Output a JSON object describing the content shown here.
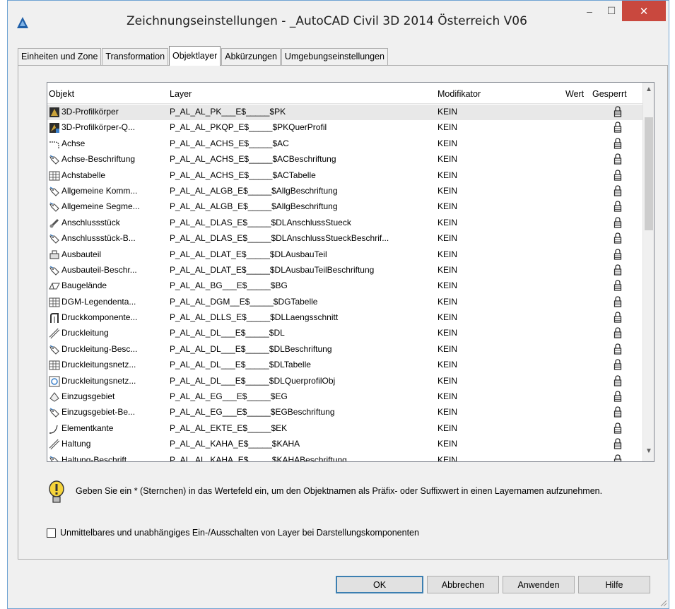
{
  "window": {
    "title": "Zeichnungseinstellungen - _AutoCAD Civil 3D 2014 Österreich V06",
    "minimize": "–",
    "maximize": "☐",
    "close": "✕"
  },
  "tabs": [
    {
      "label": "Einheiten und Zone",
      "active": false
    },
    {
      "label": "Transformation",
      "active": false
    },
    {
      "label": "Objektlayer",
      "active": true
    },
    {
      "label": "Abkürzungen",
      "active": false
    },
    {
      "label": "Umgebungseinstellungen",
      "active": false
    }
  ],
  "table": {
    "headers": {
      "object": "Objekt",
      "layer": "Layer",
      "modifier": "Modifikator",
      "value": "Wert",
      "locked": "Gesperrt"
    },
    "rows": [
      {
        "icon": "profile-body-icon",
        "object": "3D-Profilkörper",
        "layer": "P_AL_AL_PK___E$_____$PK",
        "modifier": "KEIN",
        "value": "",
        "locked": true
      },
      {
        "icon": "profile-body-cross-icon",
        "object": "3D-Profilkörper-Q...",
        "layer": "P_AL_AL_PKQP_E$_____$PKQuerProfil",
        "modifier": "KEIN",
        "value": "",
        "locked": true
      },
      {
        "icon": "alignment-icon",
        "object": "Achse",
        "layer": "P_AL_AL_ACHS_E$_____$AC",
        "modifier": "KEIN",
        "value": "",
        "locked": true
      },
      {
        "icon": "label-tag-icon",
        "object": "Achse-Beschriftung",
        "layer": "P_AL_AL_ACHS_E$_____$ACBeschriftung",
        "modifier": "KEIN",
        "value": "",
        "locked": true
      },
      {
        "icon": "table-icon",
        "object": "Achstabelle",
        "layer": "P_AL_AL_ACHS_E$_____$ACTabelle",
        "modifier": "KEIN",
        "value": "",
        "locked": true
      },
      {
        "icon": "label-tag-icon",
        "object": "Allgemeine Komm...",
        "layer": "P_AL_AL_ALGB_E$_____$AllgBeschriftung",
        "modifier": "KEIN",
        "value": "",
        "locked": true
      },
      {
        "icon": "label-tag-icon",
        "object": "Allgemeine Segme...",
        "layer": "P_AL_AL_ALGB_E$_____$AllgBeschriftung",
        "modifier": "KEIN",
        "value": "",
        "locked": true
      },
      {
        "icon": "fitting-icon",
        "object": "Anschlussstück",
        "layer": "P_AL_AL_DLAS_E$_____$DLAnschlussStueck",
        "modifier": "KEIN",
        "value": "",
        "locked": true
      },
      {
        "icon": "label-tag-icon",
        "object": "Anschlussstück-B...",
        "layer": "P_AL_AL_DLAS_E$_____$DLAnschlussStueckBeschrif...",
        "modifier": "KEIN",
        "value": "",
        "locked": true
      },
      {
        "icon": "appurtenance-icon",
        "object": "Ausbauteil",
        "layer": "P_AL_AL_DLAT_E$_____$DLAusbauTeil",
        "modifier": "KEIN",
        "value": "",
        "locked": true
      },
      {
        "icon": "label-tag-icon",
        "object": "Ausbauteil-Beschr...",
        "layer": "P_AL_AL_DLAT_E$_____$DLAusbauTeilBeschriftung",
        "modifier": "KEIN",
        "value": "",
        "locked": true
      },
      {
        "icon": "grading-icon",
        "object": "Baugelände",
        "layer": "P_AL_AL_BG___E$_____$BG",
        "modifier": "KEIN",
        "value": "",
        "locked": true
      },
      {
        "icon": "table-icon",
        "object": "DGM-Legendenta...",
        "layer": "P_AL_AL_DGM__E$_____$DGTabelle",
        "modifier": "KEIN",
        "value": "",
        "locked": true
      },
      {
        "icon": "pressure-profile-icon",
        "object": "Druckkomponente...",
        "layer": "P_AL_AL_DLLS_E$_____$DLLaengsschnitt",
        "modifier": "KEIN",
        "value": "",
        "locked": true
      },
      {
        "icon": "pipe-icon",
        "object": "Druckleitung",
        "layer": "P_AL_AL_DL___E$_____$DL",
        "modifier": "KEIN",
        "value": "",
        "locked": true
      },
      {
        "icon": "label-tag-icon",
        "object": "Druckleitung-Besc...",
        "layer": "P_AL_AL_DL___E$_____$DLBeschriftung",
        "modifier": "KEIN",
        "value": "",
        "locked": true
      },
      {
        "icon": "table-icon",
        "object": "Druckleitungsnetz...",
        "layer": "P_AL_AL_DL___E$_____$DLTabelle",
        "modifier": "KEIN",
        "value": "",
        "locked": true
      },
      {
        "icon": "pressure-section-icon",
        "object": "Druckleitungsnetz...",
        "layer": "P_AL_AL_DL___E$_____$DLQuerprofilObj",
        "modifier": "KEIN",
        "value": "",
        "locked": true
      },
      {
        "icon": "catchment-icon",
        "object": "Einzugsgebiet",
        "layer": "P_AL_AL_EG___E$_____$EG",
        "modifier": "KEIN",
        "value": "",
        "locked": true
      },
      {
        "icon": "label-tag-icon",
        "object": "Einzugsgebiet-Be...",
        "layer": "P_AL_AL_EG___E$_____$EGBeschriftung",
        "modifier": "KEIN",
        "value": "",
        "locked": true
      },
      {
        "icon": "feature-line-icon",
        "object": "Elementkante",
        "layer": "P_AL_AL_EKTE_E$_____$EK",
        "modifier": "KEIN",
        "value": "",
        "locked": true
      },
      {
        "icon": "pipe-icon",
        "object": "Haltung",
        "layer": "P_AL_AL_KAHA_E$_____$KAHA",
        "modifier": "KEIN",
        "value": "",
        "locked": true
      },
      {
        "icon": "label-tag-icon",
        "object": "Haltung-Beschrift...",
        "layer": "P_AL_AL_KAHA_E$_____$KAHABeschriftung",
        "modifier": "KEIN",
        "value": "",
        "locked": true
      }
    ]
  },
  "hint": "Geben Sie ein * (Sternchen) in das Wertefeld ein, um den Objektnamen als Präfix- oder Suffixwert in einen Layernamen aufzunehmen.",
  "checkbox": {
    "label": "Unmittelbares und unabhängiges Ein-/Ausschalten von Layer bei Darstellungskomponenten",
    "checked": false
  },
  "buttons": {
    "ok": "OK",
    "cancel": "Abbrechen",
    "apply": "Anwenden",
    "help": "Hilfe"
  },
  "colors": {
    "close_button": "#c9483e",
    "window_border": "#6fa3d3",
    "hint_icon": "#f5d33a"
  }
}
